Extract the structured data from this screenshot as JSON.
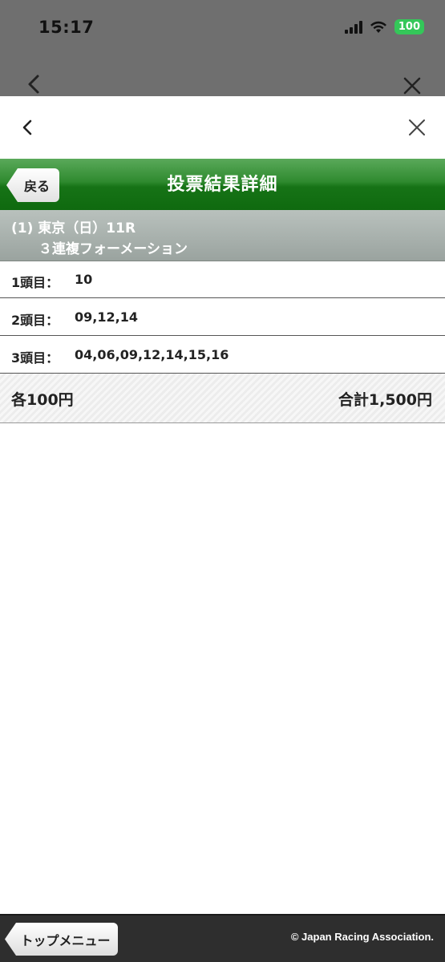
{
  "status_bar": {
    "time": "15:17",
    "battery": "100"
  },
  "header": {
    "back_label": "戻る",
    "title": "投票結果詳細"
  },
  "race": {
    "line1": "(1) 東京（日）11R",
    "line2": "３連複フォーメーション"
  },
  "rows": [
    {
      "label": "1頭目：",
      "value": "10"
    },
    {
      "label": "2頭目：",
      "value": "09,12,14"
    },
    {
      "label": "3頭目：",
      "value": "04,06,09,12,14,15,16"
    }
  ],
  "summary": {
    "unit_price": "各100円",
    "total": "合計1,500円"
  },
  "footer": {
    "top_menu_label": "トップメニュー",
    "copyright": "© Japan Racing Association."
  },
  "icons": {
    "outer_back": "chevron-left-icon",
    "outer_close": "close-icon",
    "inner_back": "chevron-left-icon",
    "inner_close": "close-icon",
    "signal": "signal-icon",
    "wifi": "wifi-icon",
    "battery": "battery-icon"
  },
  "colors": {
    "header_green": "#167316",
    "race_band": "#9aa39f",
    "footer": "#2e2e2e",
    "battery": "#34c759"
  }
}
